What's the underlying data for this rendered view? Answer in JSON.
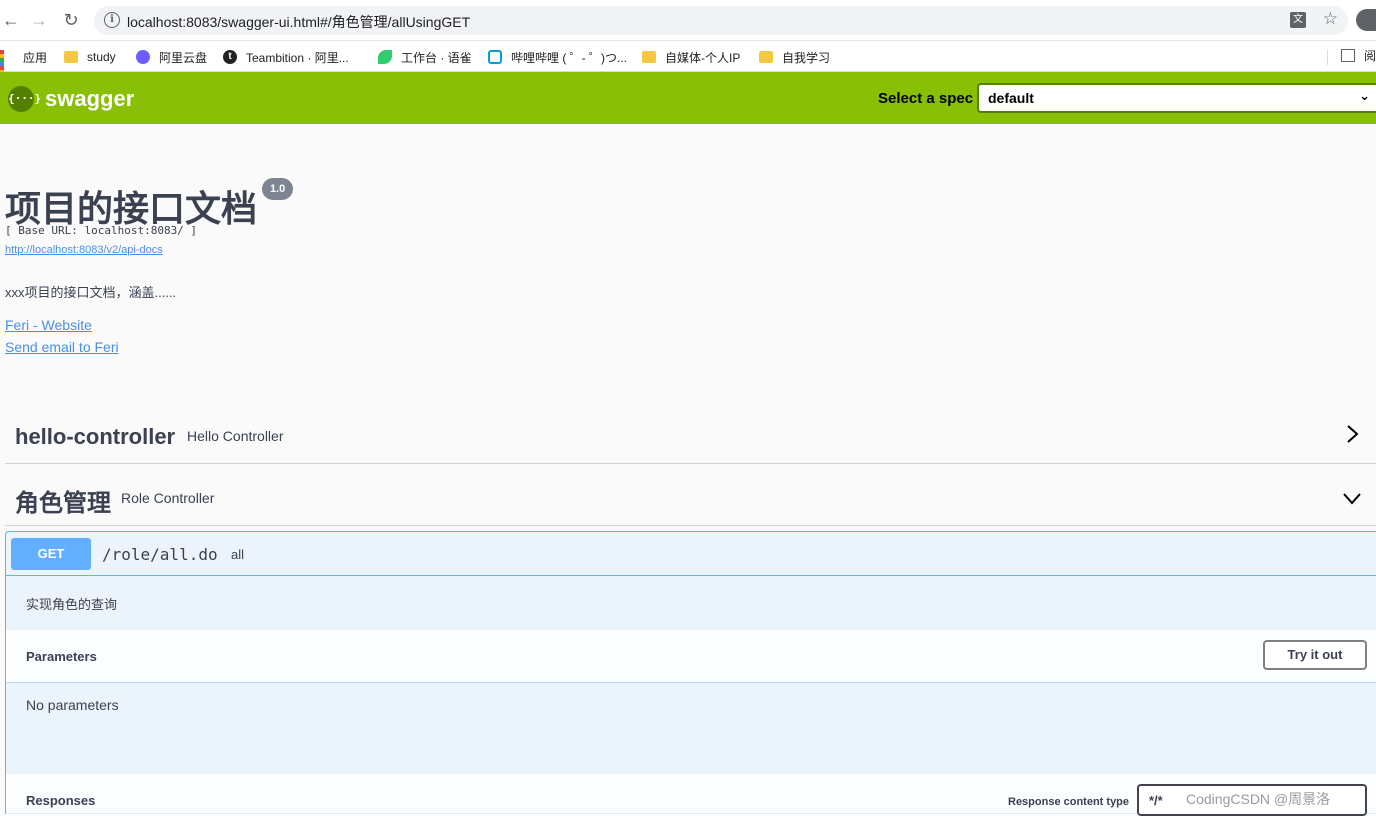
{
  "browser": {
    "url": "localhost:8083/swagger-ui.html#/角色管理/allUsingGET",
    "bookmarks": [
      {
        "label": "应用",
        "icon": "apps-icon"
      },
      {
        "label": "study",
        "icon": "folder-icon"
      },
      {
        "label": "阿里云盘",
        "icon": "aliyun-drive-icon"
      },
      {
        "label": "Teambition · 阿里...",
        "icon": "teambition-icon"
      },
      {
        "label": "工作台 · 语雀",
        "icon": "yuque-icon"
      },
      {
        "label": "哔哩哔哩 ( ゜- ゜)つ...",
        "icon": "bilibili-icon"
      },
      {
        "label": "自媒体-个人IP",
        "icon": "folder-icon"
      },
      {
        "label": "自我学习",
        "icon": "folder-icon"
      }
    ],
    "reading_list_label": "阅"
  },
  "topbar": {
    "logo_text": "swagger",
    "logo_symbol": "{···}",
    "spec_label": "Select a spec",
    "spec_value": "default"
  },
  "info": {
    "title": "项目的接口文档",
    "version": "1.0",
    "base_url": "[ Base URL: localhost:8083/ ]",
    "api_docs_link": "http://localhost:8083/v2/api-docs",
    "description": "xxx项目的接口文档，涵盖......",
    "website_link": "Feri - Website",
    "email_link": "Send email to Feri"
  },
  "tags": [
    {
      "name": "hello-controller",
      "description": "Hello Controller",
      "expanded": false
    },
    {
      "name": "角色管理",
      "description": "Role Controller",
      "expanded": true
    }
  ],
  "operation": {
    "method": "GET",
    "path": "/role/all.do",
    "summary": "all",
    "implementation_notes": "实现角色的查询",
    "parameters_label": "Parameters",
    "try_button": "Try it out",
    "no_parameters": "No parameters",
    "responses_label": "Responses",
    "response_content_type_label": "Response content type",
    "response_content_type_value": "*/*"
  },
  "watermark": "CodingCSDN @周景洛",
  "colors": {
    "swagger_green": "#89bf04",
    "get_blue": "#61affe",
    "link_blue": "#4990e2"
  }
}
